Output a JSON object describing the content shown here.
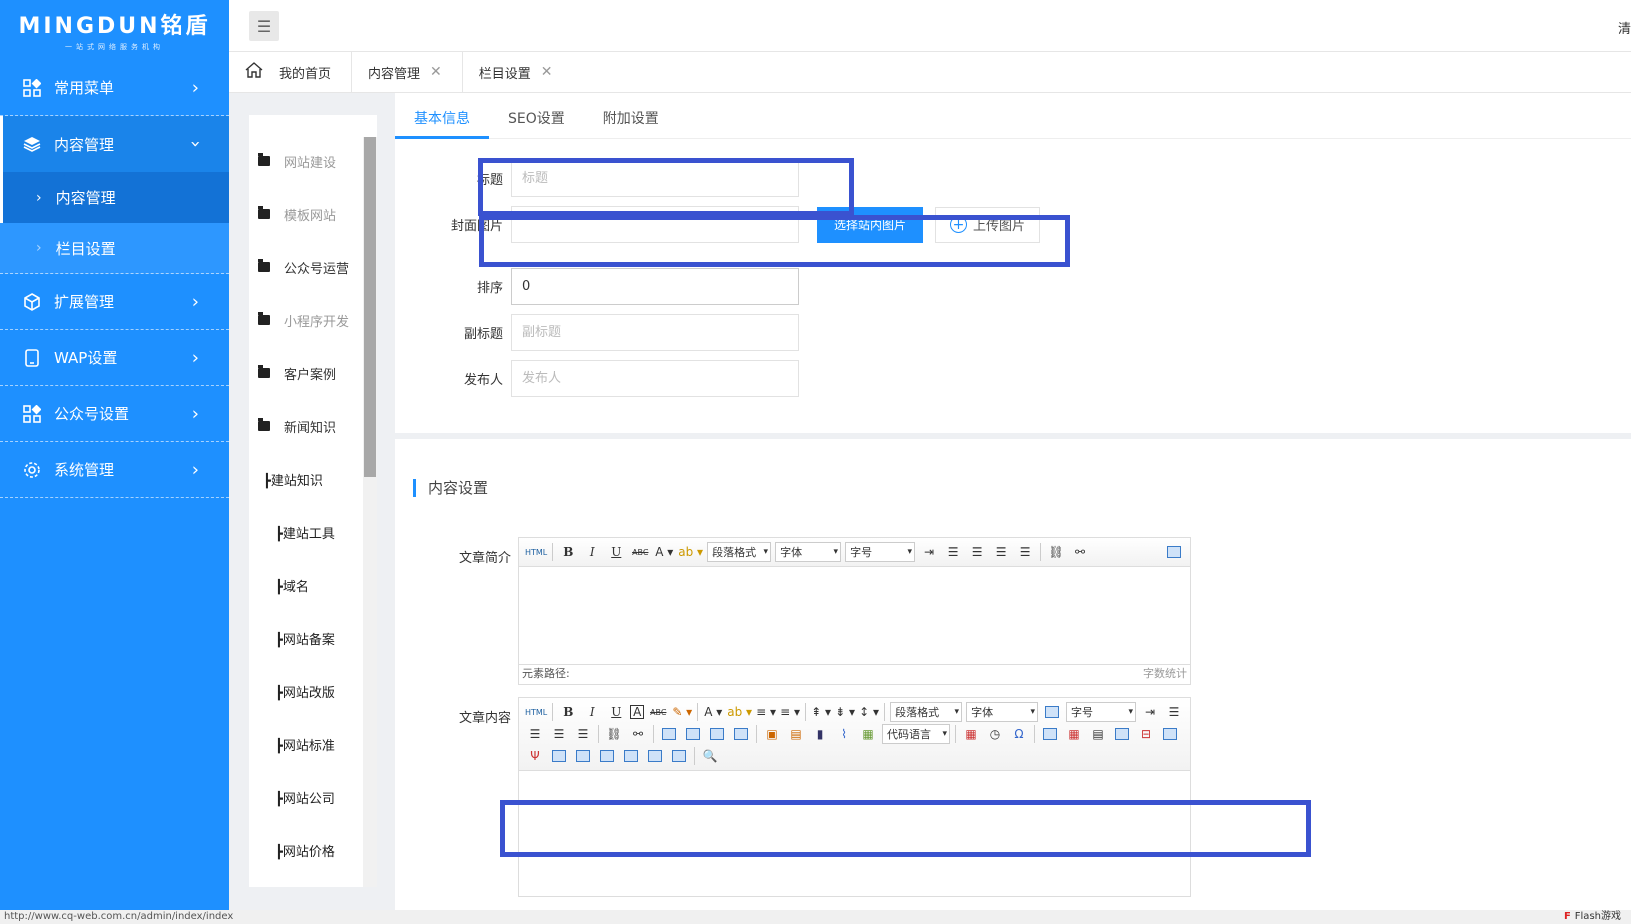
{
  "logo": {
    "brand": "MINGDUN铭盾",
    "slogan": "一站式网络服务机构"
  },
  "sidebar": {
    "items": [
      {
        "label": "常用菜单",
        "icon": "grid-icon"
      },
      {
        "label": "内容管理",
        "icon": "layers-icon",
        "expanded": true,
        "children": [
          {
            "label": "内容管理",
            "active": true
          },
          {
            "label": "栏目设置"
          }
        ]
      },
      {
        "label": "扩展管理",
        "icon": "cube-icon"
      },
      {
        "label": "WAP设置",
        "icon": "tablet-icon"
      },
      {
        "label": "公众号设置",
        "icon": "grid-icon"
      },
      {
        "label": "系统管理",
        "icon": "gear-icon"
      }
    ]
  },
  "topbar": {
    "right_text": "清"
  },
  "tabs": [
    {
      "label": "我的首页"
    },
    {
      "label": "内容管理",
      "closable": true
    },
    {
      "label": "栏目设置",
      "closable": true
    }
  ],
  "tree": {
    "nodes": [
      {
        "label": "网站建设",
        "type": "folder",
        "dim": true
      },
      {
        "label": "模板网站",
        "type": "folder",
        "dim": true
      },
      {
        "label": "公众号运营",
        "type": "folder"
      },
      {
        "label": "小程序开发",
        "type": "folder",
        "dim": true
      },
      {
        "label": "客户案例",
        "type": "folder"
      },
      {
        "label": "新闻知识",
        "type": "folder-open"
      },
      {
        "label": "┣建站知识",
        "type": "child"
      },
      {
        "label": "┣建站工具",
        "type": "child"
      },
      {
        "label": "┣域名",
        "type": "child"
      },
      {
        "label": "┣网站备案",
        "type": "child"
      },
      {
        "label": "┣网站改版",
        "type": "child"
      },
      {
        "label": "┣网站标准",
        "type": "child"
      },
      {
        "label": "┣网站公司",
        "type": "child"
      },
      {
        "label": "┣网站价格",
        "type": "child"
      }
    ]
  },
  "form": {
    "tabs": [
      {
        "label": "基本信息",
        "active": true
      },
      {
        "label": "SEO设置"
      },
      {
        "label": "附加设置"
      }
    ],
    "title": {
      "label": "标题",
      "placeholder": "标题",
      "value": ""
    },
    "cover": {
      "label": "封面图片",
      "value": "",
      "select_button": "选择站内图片",
      "upload_button": "上传图片"
    },
    "sort": {
      "label": "排序",
      "value": "0"
    },
    "subtitle": {
      "label": "副标题",
      "placeholder": "副标题",
      "value": ""
    },
    "author": {
      "label": "发布人",
      "placeholder": "发布人",
      "value": ""
    }
  },
  "content": {
    "section_title": "内容设置",
    "summary_label": "文章简介",
    "body_label": "文章内容",
    "summary_editor": {
      "selects": {
        "paragraph": "段落格式",
        "font": "字体",
        "size": "字号"
      },
      "footer_path": "元素路径:",
      "footer_count": "字数统计"
    },
    "body_editor": {
      "selects": {
        "paragraph": "段落格式",
        "font": "字体",
        "size": "字号",
        "code": "代码语言"
      }
    }
  },
  "status": {
    "url": "http://www.cq-web.com.cn/admin/index/index",
    "right": "Flash游戏"
  },
  "colors": {
    "primary": "#1e90ff",
    "annotation": "#3a52d0"
  }
}
